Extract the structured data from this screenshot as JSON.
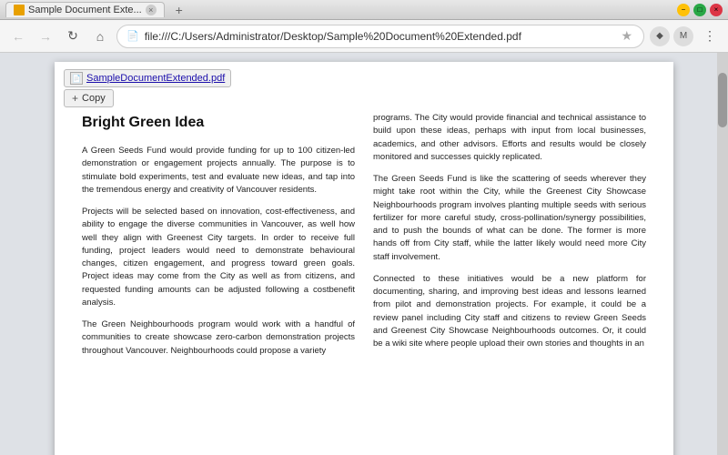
{
  "titlebar": {
    "tab_title": "Sample Document Exte...",
    "minimize_label": "−",
    "maximize_label": "□",
    "close_label": "×"
  },
  "navbar": {
    "address": "file:///C:/Users/Administrator/Desktop/Sample%20Document%20Extended.pdf"
  },
  "pdf": {
    "filename": "SampleDocumentExtended.pdf",
    "copy_label": "Copy",
    "title": "Bright Green Idea",
    "col1": [
      "A Green Seeds Fund would provide funding for up to 100 citizen-led demonstration or engagement projects annually. The purpose is to stimulate bold experiments, test and evaluate new ideas, and tap into the tremendous energy and creativity of Vancouver residents.",
      "Projects will be selected based on innovation, cost-effectiveness, and ability to engage the diverse communities in Vancouver, as well how well they align with Greenest City targets. In order to receive full funding, project leaders would need to demonstrate behavioural changes, citizen engagement, and progress toward green goals. Project ideas may come from the City as well as from citizens, and requested funding amounts can be adjusted following a costbenefit analysis.",
      "The Green Neighbourhoods program would work with a handful of communities to create showcase zero-carbon demonstration projects throughout Vancouver. Neighbourhoods could propose a variety"
    ],
    "col2": [
      "programs. The City would provide financial and technical assistance to build upon these ideas, perhaps with input from local businesses, academics, and other advisors. Efforts and results would be closely monitored and successes quickly replicated.",
      "The Green Seeds Fund is like the scattering of seeds wherever they might take root within the City, while the Greenest City Showcase Neighbourhoods program involves planting multiple seeds with serious fertilizer for more careful study, cross-pollination/synergy possibilities, and to push the bounds of what can be done. The former is more hands off from City staff, while the latter likely would need more City staff involvement.",
      "Connected to these initiatives would be a new platform for documenting, sharing, and improving best ideas and lessons learned from pilot and demonstration projects. For example, it could be a review panel including City staff and citizens to review Green Seeds and Greenest City Showcase Neighbourhoods outcomes. Or, it could be a wiki site where people upload their own stories and thoughts in an"
    ]
  }
}
